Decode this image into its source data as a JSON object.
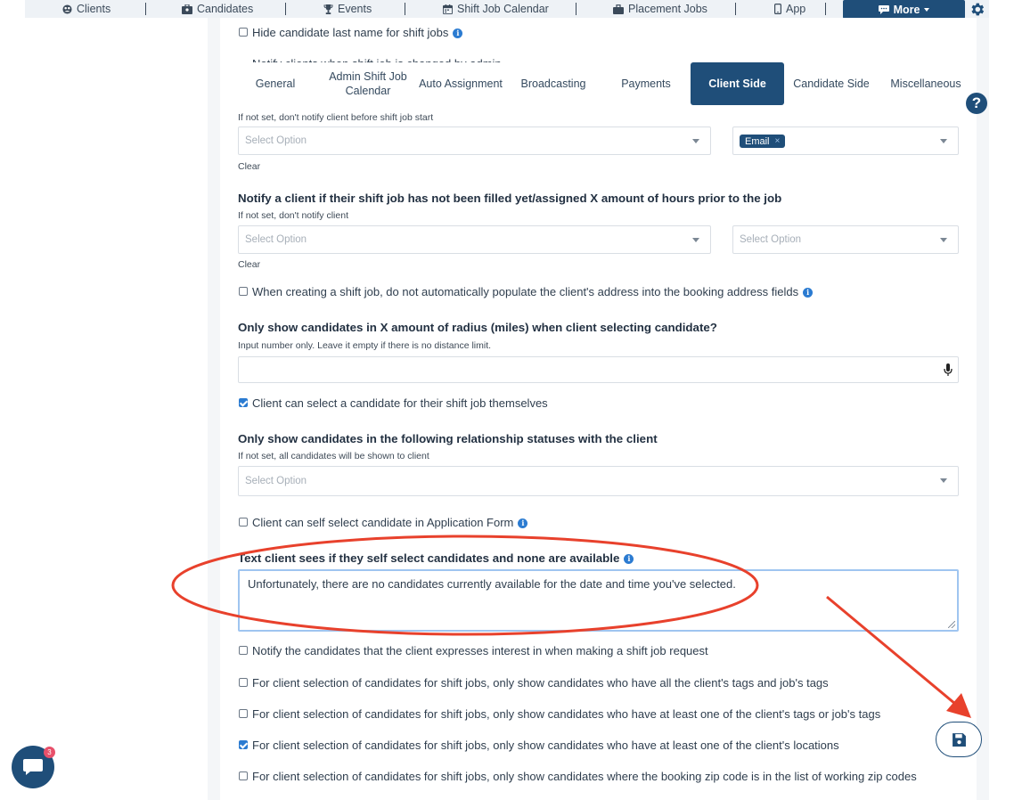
{
  "nav": {
    "items": [
      {
        "label": "Clients",
        "icon": "clients-icon"
      },
      {
        "label": "Candidates",
        "icon": "candidates-icon"
      },
      {
        "label": "Events",
        "icon": "trophy-icon"
      },
      {
        "label": "Shift Job Calendar",
        "icon": "calendar-icon"
      },
      {
        "label": "Placement Jobs",
        "icon": "briefcase-icon"
      },
      {
        "label": "App",
        "icon": "phone-icon"
      }
    ],
    "more_label": "More",
    "accent": "#1f4e79"
  },
  "top_partial": {
    "hide_last_name": "Hide candidate last name for shift jobs",
    "notify_clients_partial": "Notify clients when shift job is changed by admin"
  },
  "tabs": [
    {
      "label": "General",
      "active": false
    },
    {
      "label": "Admin Shift Job Calendar",
      "active": false
    },
    {
      "label": "Auto Assignment",
      "active": false
    },
    {
      "label": "Broadcasting",
      "active": false
    },
    {
      "label": "Payments",
      "active": false
    },
    {
      "label": "Client Side",
      "active": true
    },
    {
      "label": "Candidate Side",
      "active": false
    },
    {
      "label": "Miscellaneous",
      "active": false
    }
  ],
  "help_label": "?",
  "section1": {
    "hint": "If not set, don't notify client before shift job start",
    "select_placeholder": "Select Option",
    "chip": "Email",
    "clear": "Clear"
  },
  "section2": {
    "title": "Notify a client if their shift job has not been filled yet/assigned X amount of hours prior to the job",
    "hint": "If not set, don't notify client",
    "select_left": "Select Option",
    "select_right": "Select Option",
    "clear": "Clear"
  },
  "opt_populate": "When creating a shift job, do not automatically populate the client's address into the booking address fields",
  "radius": {
    "title": "Only show candidates in X amount of radius (miles) when client selecting candidate?",
    "hint": "Input number only. Leave it empty if there is no distance limit.",
    "value": ""
  },
  "opt_client_select": "Client can select a candidate for their shift job themselves",
  "relationship": {
    "title": "Only show candidates in the following relationship statuses with the client",
    "hint": "If not set, all candidates will be shown to client",
    "placeholder": "Select Option"
  },
  "opt_self_select_form": "Client can self select candidate in Application Form",
  "none_available": {
    "title": "Text client sees if they self select candidates and none are available",
    "value": "Unfortunately, there are no candidates currently available for the date and time you've selected."
  },
  "options": [
    {
      "label": "Notify the candidates that the client expresses interest in when making a shift job request",
      "checked": false
    },
    {
      "label": "For client selection of candidates for shift jobs, only show candidates who have all the client's tags and job's tags",
      "checked": false
    },
    {
      "label": "For client selection of candidates for shift jobs, only show candidates who have at least one of the client's tags or job's tags",
      "checked": false
    },
    {
      "label": "For client selection of candidates for shift jobs, only show candidates who have at least one of the client's locations",
      "checked": true
    },
    {
      "label": "For client selection of candidates for shift jobs, only show candidates where the booking zip code is in the list of working zip codes",
      "checked": false
    }
  ],
  "chat_badge": "3",
  "annotation_color": "#e8412c"
}
